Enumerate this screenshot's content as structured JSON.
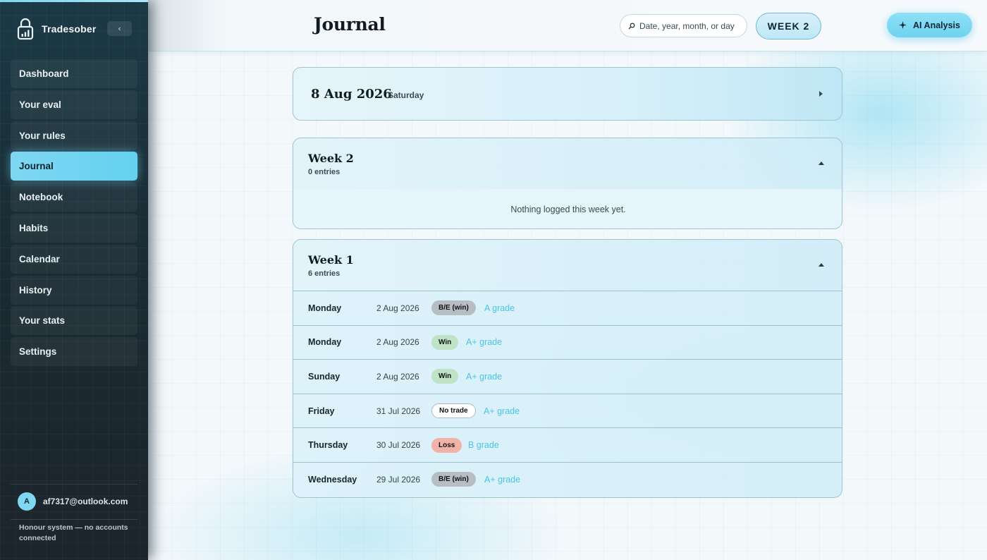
{
  "sidebar": {
    "brand": "Tradesober",
    "collapse_label": "‹",
    "items": [
      {
        "label": "Dashboard"
      },
      {
        "label": "Your eval"
      },
      {
        "label": "Your rules"
      },
      {
        "label": "Journal",
        "active": true
      },
      {
        "label": "Notebook"
      },
      {
        "label": "Habits"
      },
      {
        "label": "Calendar"
      },
      {
        "label": "History"
      },
      {
        "label": "Your stats"
      },
      {
        "label": "Settings"
      }
    ],
    "user": {
      "initial": "A",
      "email": "af7317@outlook.com"
    },
    "footer_note": "Honour system — no accounts connected"
  },
  "header": {
    "title": "Journal",
    "search_placeholder": "Date, year, month, or day",
    "week_button": "WEEK 2",
    "ai_button": "AI Analysis"
  },
  "date_card": {
    "date": "8 Aug 2026",
    "weekday": "Saturday"
  },
  "week2": {
    "title": "Week 2",
    "count": "0 entries",
    "empty_text": "Nothing logged this week yet."
  },
  "week1": {
    "title": "Week 1",
    "count": "6 entries",
    "entries": [
      {
        "day": "Monday",
        "date": "2 Aug 2026",
        "result": "B/E (win)",
        "result_type": "be",
        "grade": "A grade"
      },
      {
        "day": "Monday",
        "date": "2 Aug 2026",
        "result": "Win",
        "result_type": "win",
        "grade": "A+ grade"
      },
      {
        "day": "Sunday",
        "date": "2 Aug 2026",
        "result": "Win",
        "result_type": "win",
        "grade": "A+ grade"
      },
      {
        "day": "Friday",
        "date": "31 Jul 2026",
        "result": "No trade",
        "result_type": "notrade",
        "grade": "A+ grade"
      },
      {
        "day": "Thursday",
        "date": "30 Jul 2026",
        "result": "Loss",
        "result_type": "loss",
        "grade": "B grade"
      },
      {
        "day": "Wednesday",
        "date": "29 Jul 2026",
        "result": "B/E (win)",
        "result_type": "be",
        "grade": "A+ grade"
      }
    ]
  },
  "colors": {
    "accent": "#7fd7f2",
    "grade_text": "#4cc3e6",
    "sidebar_bg": "#1c2b33"
  },
  "icons": {
    "brand": "lock-chart-icon",
    "search": "search-icon",
    "ai": "sparkle-icon",
    "expand": "chevron-right-icon",
    "collapse": "chevron-up-icon"
  }
}
